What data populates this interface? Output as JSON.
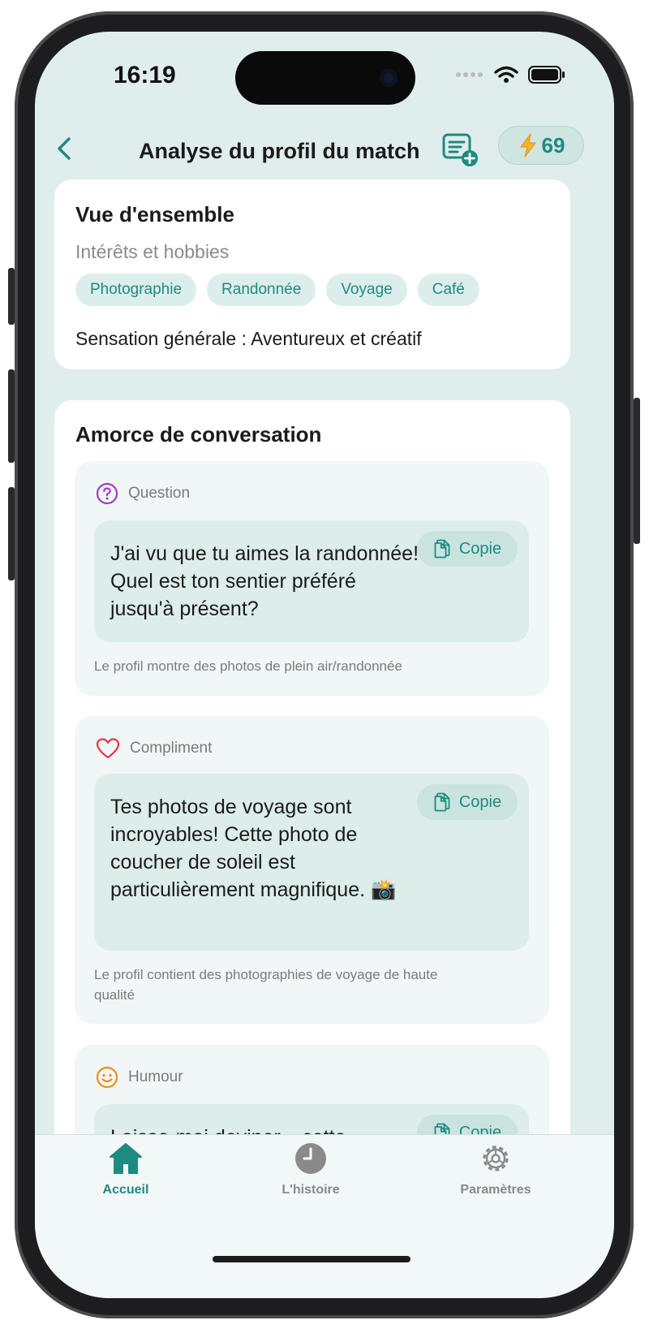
{
  "status": {
    "time": "16:19"
  },
  "header": {
    "title": "Analyse du profil du match",
    "credits": "69"
  },
  "overview": {
    "title": "Vue d'ensemble",
    "interests_label": "Intérêts et hobbies",
    "tags": [
      "Photographie",
      "Randonnée",
      "Voyage",
      "Café"
    ],
    "feeling": "Sensation générale : Aventureux et créatif"
  },
  "starters": {
    "title": "Amorce de conversation",
    "copy_label": "Copie",
    "items": [
      {
        "type": "Question",
        "icon": "question-icon",
        "text": "J'ai vu que tu aimes la randonnée! Quel est ton sentier préféré jusqu'à présent?",
        "reason": "Le profil montre des photos de plein air/randonnée"
      },
      {
        "type": "Compliment",
        "icon": "heart-icon",
        "text": "Tes photos de voyage sont incroyables! Cette photo de coucher de soleil est particulièrement magnifique. 📸",
        "reason": "Le profil contient des photographies de voyage de haute qualité"
      },
      {
        "type": "Humour",
        "icon": "smile-icon",
        "text": "Laisse-moi deviner... cette",
        "reason": ""
      }
    ]
  },
  "tabbar": {
    "tabs": [
      {
        "label": "Accueil",
        "icon": "home-icon",
        "active": true
      },
      {
        "label": "L'histoire",
        "icon": "clock-icon",
        "active": false
      },
      {
        "label": "Paramètres",
        "icon": "gear-icon",
        "active": false
      }
    ]
  },
  "colors": {
    "accent": "#1f8a80",
    "background": "#dfeeed",
    "question": "#a23cc9",
    "compliment": "#e23b4d",
    "humour": "#ef8b1c"
  }
}
